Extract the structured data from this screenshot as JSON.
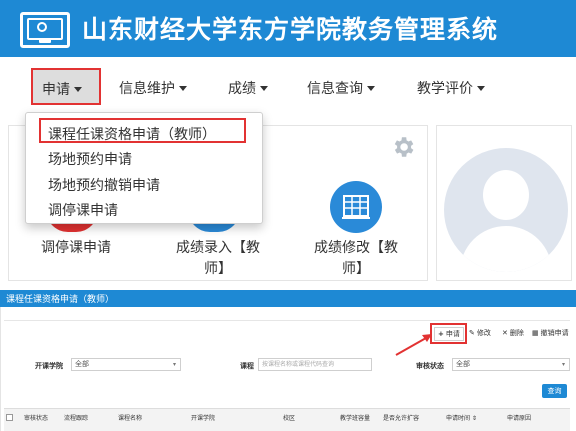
{
  "header": {
    "title": "山东财经大学东方学院教务管理系统",
    "logo_icon": "teacher-board-icon",
    "color": "#1e89d4"
  },
  "nav": {
    "items": [
      {
        "label": "申请",
        "active": true
      },
      {
        "label": "信息维护"
      },
      {
        "label": "成绩"
      },
      {
        "label": "信息查询"
      },
      {
        "label": "教学评价"
      }
    ]
  },
  "dropdown": {
    "items": [
      {
        "label": "课程任课资格申请（教师）",
        "highlighted": true
      },
      {
        "label": "场地预约申请"
      },
      {
        "label": "场地预约撤销申请"
      },
      {
        "label": "调停课申请"
      }
    ]
  },
  "tiles": [
    {
      "label": "调停课申请"
    },
    {
      "label_line1": "成绩录入【教",
      "label_line2": "师】"
    },
    {
      "label_line1": "成绩修改【教",
      "label_line2": "师】"
    }
  ],
  "sub": {
    "title": "课程任课资格申请（教师）",
    "toolbar": [
      {
        "icon": "+",
        "label": "申请"
      },
      {
        "icon": "✎",
        "label": "修改"
      },
      {
        "icon": "✕",
        "label": "删除"
      },
      {
        "icon": "▦",
        "label": "撤销申请"
      }
    ],
    "filters": {
      "college_label": "开课学院",
      "college_value": "全部",
      "course_label": "课程",
      "course_placeholder": "按课程名称或课程代码查询",
      "status_label": "审核状态",
      "status_value": "全部"
    },
    "query_button": "查询",
    "columns": [
      "审核状态",
      "流程跟踪",
      "课程名称",
      "开课学院",
      "校区",
      "教学班容量",
      "是否允许扩容",
      "申请时间 ⇕",
      "申请原因"
    ]
  },
  "colors": {
    "brand_blue": "#1e89d4",
    "highlight_red": "#e23232"
  }
}
